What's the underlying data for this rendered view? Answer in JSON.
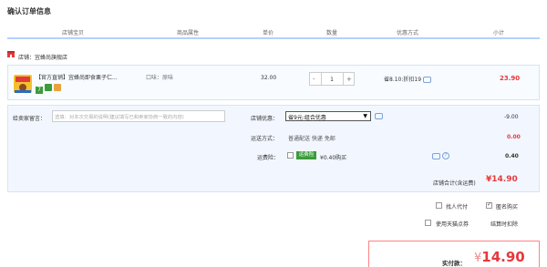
{
  "page_title": "确认订单信息",
  "columns": [
    "店铺宝贝",
    "商品属性",
    "单价",
    "数量",
    "优惠方式",
    "小计"
  ],
  "shop": {
    "label": "店铺：",
    "name": "宜蜂尚旗舰店"
  },
  "item": {
    "name": "【官方直销】宜蜂尚即食栗子仁...",
    "attr": "口味：原味",
    "price": "32.00",
    "quantity": "1",
    "minus": "-",
    "plus": "+",
    "promo": "省8.10:折扣19",
    "subtotal": "23.90"
  },
  "message": {
    "label": "给卖家留言：",
    "placeholder": "选填：对本次交易的说明(建议填写已和卖家协商一致的内容)"
  },
  "shop_promo": {
    "label": "店铺优惠：",
    "selected": "省9元:组合优惠",
    "amount": "-9.00"
  },
  "shipping": {
    "label": "运送方式：",
    "text": "普通配送 快递 免邮",
    "amount": "0.00"
  },
  "insurance": {
    "label": "运费险：",
    "badge": "运费险",
    "text": "¥0.40购买",
    "amount": "0.40"
  },
  "shop_total": {
    "label": "店铺合计(含运费)",
    "value": "¥14.90"
  },
  "options": {
    "proxy": "找人代付",
    "anonymous": "匿名购买",
    "tmall_points": "使用天猫点券",
    "settle": "结算时扣除"
  },
  "pay": {
    "label": "实付款：",
    "currency": "¥",
    "value": "14.90"
  }
}
